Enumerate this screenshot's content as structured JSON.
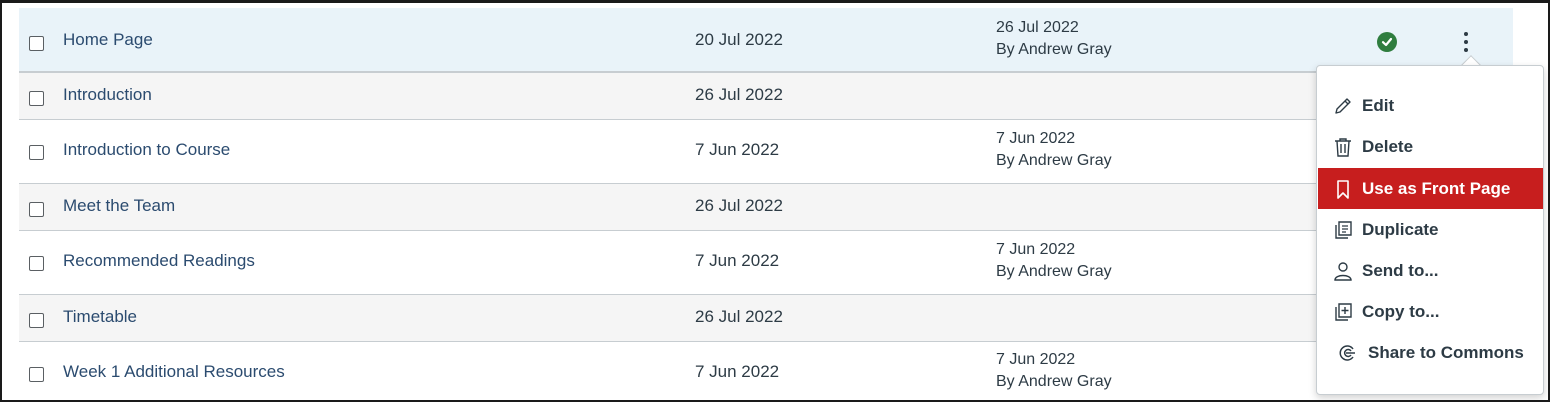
{
  "rows": [
    {
      "title": "Home Page",
      "created": "20 Jul 2022",
      "edited_date": "26 Jul 2022",
      "edited_by": "By Andrew Gray",
      "published": true
    },
    {
      "title": "Introduction",
      "created": "26 Jul 2022",
      "edited_date": "",
      "edited_by": ""
    },
    {
      "title": "Introduction to Course",
      "created": "7 Jun 2022",
      "edited_date": "7 Jun 2022",
      "edited_by": "By Andrew Gray"
    },
    {
      "title": "Meet the Team",
      "created": "26 Jul 2022",
      "edited_date": "",
      "edited_by": ""
    },
    {
      "title": "Recommended Readings",
      "created": "7 Jun 2022",
      "edited_date": "7 Jun 2022",
      "edited_by": "By Andrew Gray"
    },
    {
      "title": "Timetable",
      "created": "26 Jul 2022",
      "edited_date": "",
      "edited_by": ""
    },
    {
      "title": "Week 1 Additional Resources",
      "created": "7 Jun 2022",
      "edited_date": "7 Jun 2022",
      "edited_by": "By Andrew Gray"
    }
  ],
  "menu": {
    "items": [
      {
        "label": "Edit",
        "icon": "pencil-icon"
      },
      {
        "label": "Delete",
        "icon": "trash-icon"
      },
      {
        "label": "Use as Front Page",
        "icon": "bookmark-icon",
        "active": true
      },
      {
        "label": "Duplicate",
        "icon": "duplicate-icon"
      },
      {
        "label": "Send to...",
        "icon": "user-icon"
      },
      {
        "label": "Copy to...",
        "icon": "copy-icon"
      },
      {
        "label": "Share to Commons",
        "icon": "commons-icon"
      }
    ]
  },
  "colors": {
    "link": "#2b4b6f",
    "text": "#2d3b45",
    "published": "#2f7d3f",
    "menu_active": "#c71e1e",
    "selected_row": "#e9f3f9"
  }
}
